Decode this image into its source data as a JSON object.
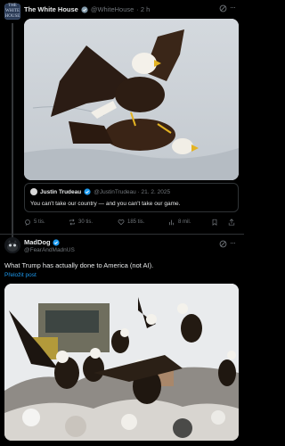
{
  "post1": {
    "author": "The White House",
    "handle": "@WhiteHouse",
    "time": "· 2 h",
    "avatar_text": "THE WHITE HOUSE",
    "media_icon": "eagles-fighting-on-ice-photo",
    "quote": {
      "author": "Justin Trudeau",
      "handle": "@JustinTrudeau · 21. 2. 2025",
      "text": "You can't take our country — and you can't take our game."
    },
    "actions": {
      "replies": "5 tis.",
      "reposts": "30 tis.",
      "likes": "185 tis.",
      "views": "8 mil."
    }
  },
  "post2": {
    "author": "MadDog",
    "handle": "@FearAndMadnUS",
    "text": "What Trump has actually done to America (not AI).",
    "translate_label": "Přeložit post",
    "media_icon": "eagles-on-landfill-photo"
  },
  "colors": {
    "background": "#000000",
    "text": "#e7e9ea",
    "muted": "#71767b",
    "accent": "#1d9bf0",
    "border": "#2f3336"
  }
}
